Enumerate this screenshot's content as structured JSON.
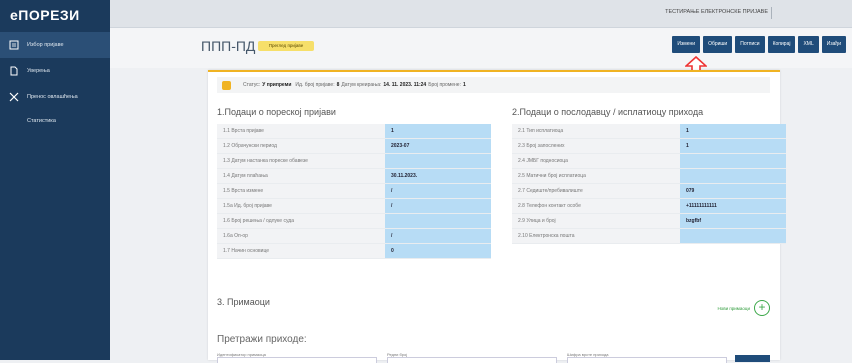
{
  "sidebar": {
    "logo": "еПОРЕЗИ",
    "items": [
      {
        "icon": "form-icon",
        "label": "Избор пријаве",
        "active": true
      },
      {
        "icon": "document-icon",
        "label": "Уверења",
        "active": false
      },
      {
        "icon": "arrows-icon",
        "label": "Пренос овлашћења",
        "active": false
      },
      {
        "icon": "",
        "label": "Статистика",
        "active": false
      }
    ]
  },
  "topbar": {
    "test_label": "ТЕСТИРАЊЕ ЕЛЕКТРОНСКЕ ПРИЈАВЕ"
  },
  "header": {
    "title": "ППП-ПД",
    "badge": "Преглед пријаве",
    "buttons": [
      "Измени",
      "Обриши",
      "Потписи",
      "Копирај",
      "XML",
      "Изађи"
    ]
  },
  "status": {
    "label": "Статус:",
    "status_value": "У припреми",
    "id_label": "Ид. број пријаве:",
    "id_value": "8",
    "date_label": "Датум креирања:",
    "date_value": "14. 11. 2023. 11:24",
    "rev_label": "Број промене:",
    "rev_value": "1"
  },
  "section1": {
    "title": "1.Подаци о пореској пријави",
    "rows": [
      {
        "label": "1.1 Врста пријаве",
        "value": "1"
      },
      {
        "label": "1.2 Обрачунски период",
        "value": "2023-07"
      },
      {
        "label": "1.3 Датум настанка пореске обавезе",
        "value": ""
      },
      {
        "label": "1.4 Датум плаћања",
        "value": "30.11.2023."
      },
      {
        "label": "1.5 Врста измене",
        "value": "/"
      },
      {
        "label": "1.5a Ид. број пријаве",
        "value": "/"
      },
      {
        "label": "1.6 Број решења / одлуке суда",
        "value": ""
      },
      {
        "label": "1.6a Оп-ор",
        "value": "/"
      },
      {
        "label": "1.7 Начин основице",
        "value": "0"
      }
    ]
  },
  "section2": {
    "title": "2.Подаци о послодавцу / исплатиоцу прихода",
    "rows": [
      {
        "label": "2.1 Тип исплатиоца",
        "value": "1"
      },
      {
        "label": "2.3 Број запослених",
        "value": "1"
      },
      {
        "label": "2.4 ЈМБГ подносиоца",
        "value": ""
      },
      {
        "label": "2.5 Матични број исплатиоца",
        "value": ""
      },
      {
        "label": "2.7 Седиште/пребивалиште",
        "value": "079"
      },
      {
        "label": "2.8 Телефон контакт особе",
        "value": "+11111111111"
      },
      {
        "label": "2.9 Улица и број",
        "value": "bzgfbf"
      },
      {
        "label": "2.10 Електронска пошта",
        "value": ""
      }
    ]
  },
  "section3": {
    "title": "3. Примаоци",
    "add_label": "Нови примаоци"
  },
  "search": {
    "title": "Претражи приходе:",
    "fields": [
      "Идентификатор примаоца",
      "Редни број",
      "Шифра врсте прихода"
    ]
  },
  "colors": {
    "sidebar": "#1b3a5c",
    "accent": "#f0b323",
    "button": "#1f4c7a",
    "value_cell": "#b7dcf5",
    "add": "#3da84a"
  }
}
